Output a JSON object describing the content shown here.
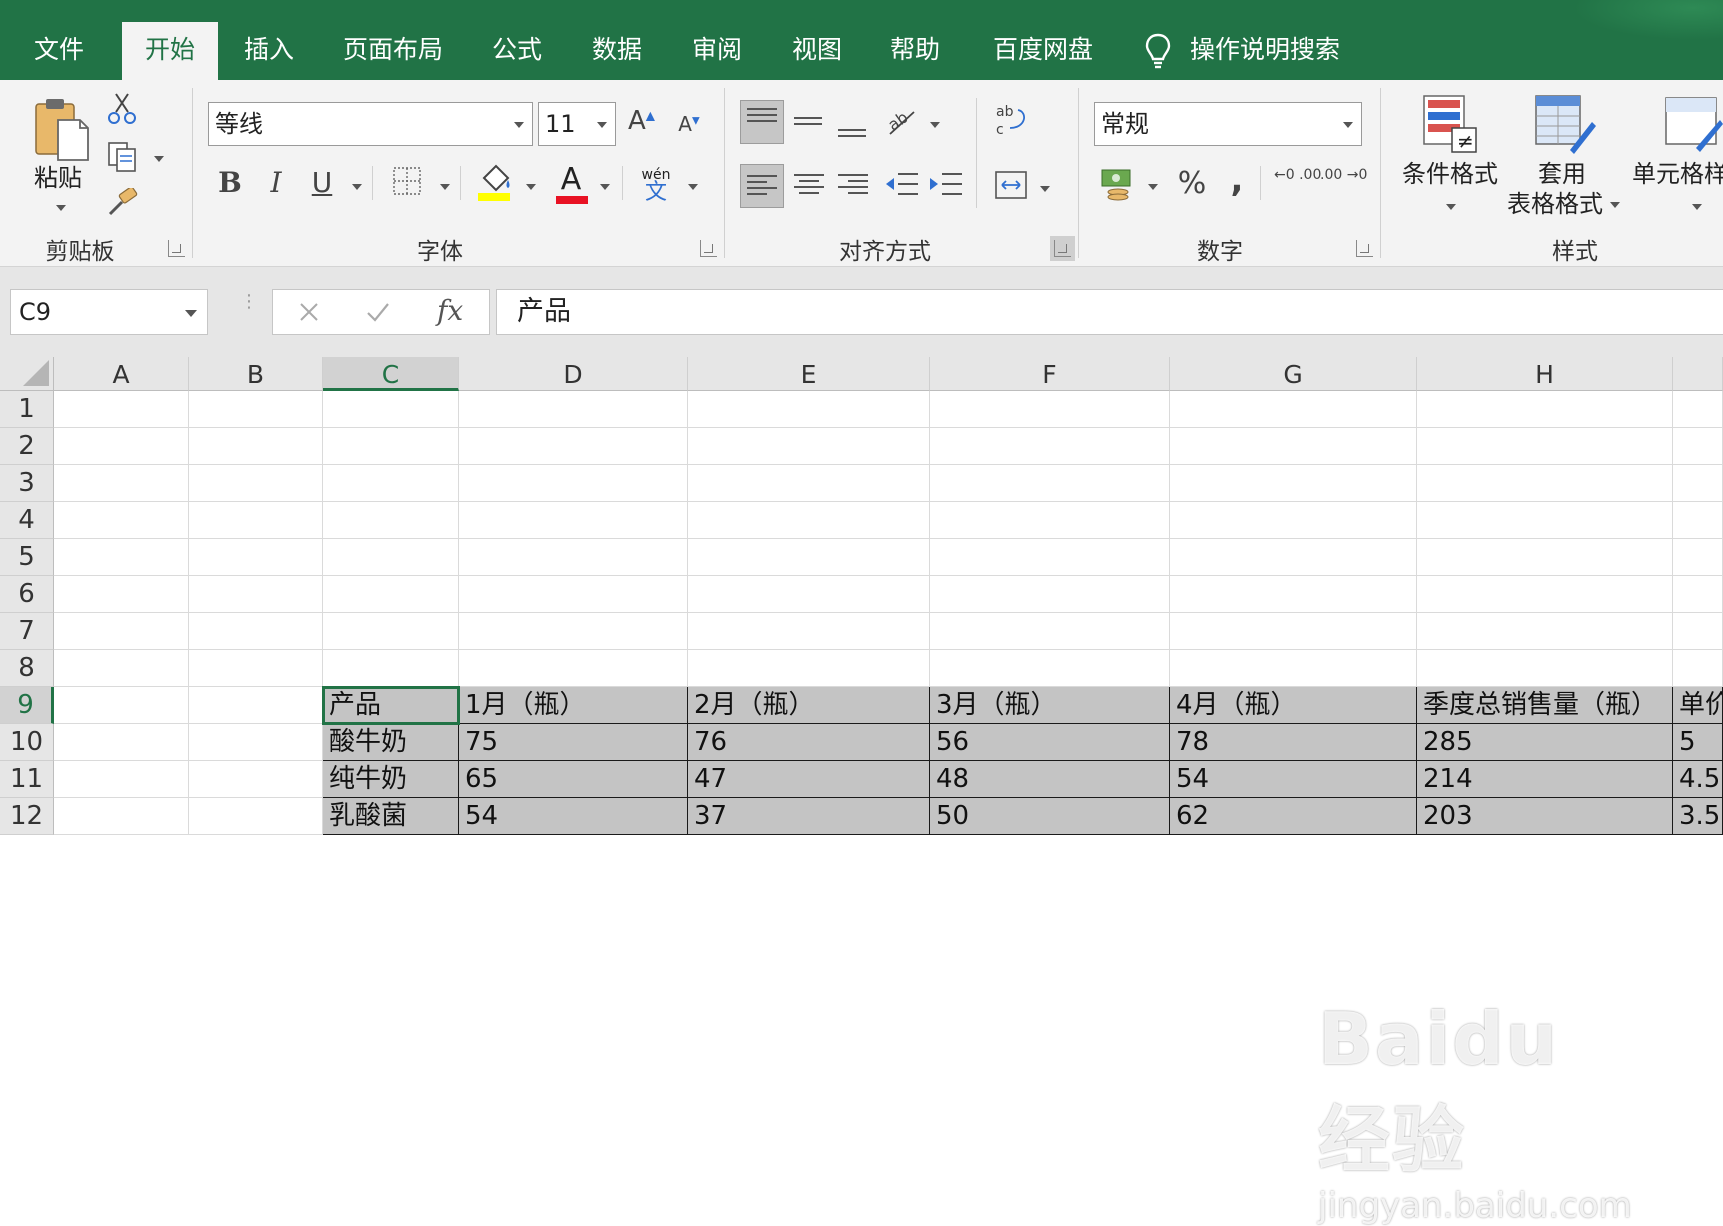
{
  "tabs": [
    {
      "label": "文件",
      "active": false
    },
    {
      "label": "开始",
      "active": true
    },
    {
      "label": "插入",
      "active": false
    },
    {
      "label": "页面布局",
      "active": false
    },
    {
      "label": "公式",
      "active": false
    },
    {
      "label": "数据",
      "active": false
    },
    {
      "label": "审阅",
      "active": false
    },
    {
      "label": "视图",
      "active": false
    },
    {
      "label": "帮助",
      "active": false
    },
    {
      "label": "百度网盘",
      "active": false
    }
  ],
  "tell_me": "操作说明搜索",
  "ribbon": {
    "clipboard": {
      "paste_label": "粘贴",
      "group_label": "剪贴板"
    },
    "font": {
      "name": "等线",
      "size": "11",
      "bold": "B",
      "italic": "I",
      "underline": "U",
      "grow_label": "A",
      "shrink_label": "A",
      "color_label": "A",
      "phonetic_top": "wén",
      "phonetic_bottom": "文",
      "fill_color": "#ffff00",
      "font_color": "#e81123",
      "group_label": "字体"
    },
    "alignment": {
      "group_label": "对齐方式"
    },
    "number": {
      "format": "常规",
      "percent": "%",
      "comma": ",",
      "inc_decimal": "←0 .00",
      "dec_decimal": ".00 →0",
      "group_label": "数字"
    },
    "styles": {
      "conditional": "条件格式",
      "table_line1": "套用",
      "table_line2": "表格格式",
      "cell_styles": "单元格样",
      "group_label": "样式"
    }
  },
  "formula_bar": {
    "name_box": "C9",
    "fx": "fx",
    "content": "产品"
  },
  "grid": {
    "columns": [
      "A",
      "B",
      "C",
      "D",
      "E",
      "F",
      "G",
      "H",
      ""
    ],
    "selected_column": "C",
    "rows": [
      "1",
      "2",
      "3",
      "4",
      "5",
      "6",
      "7",
      "8",
      "9",
      "10",
      "11",
      "12"
    ],
    "selected_row": "9",
    "table": [
      [
        "产品",
        "1月（瓶）",
        "2月（瓶）",
        "3月（瓶）",
        "4月（瓶）",
        "季度总销售量（瓶）",
        "单价"
      ],
      [
        "酸牛奶",
        "75",
        "76",
        "56",
        "78",
        "285",
        "5"
      ],
      [
        "纯牛奶",
        "65",
        "47",
        "48",
        "54",
        "214",
        "4.5"
      ],
      [
        "乳酸菌",
        "54",
        "37",
        "50",
        "62",
        "203",
        "3.5"
      ]
    ]
  },
  "watermark": {
    "line1": "Baidu经验",
    "line2": "jingyan.baidu.com"
  },
  "colors": {
    "brand": "#217346",
    "callout": "#e8202a"
  }
}
